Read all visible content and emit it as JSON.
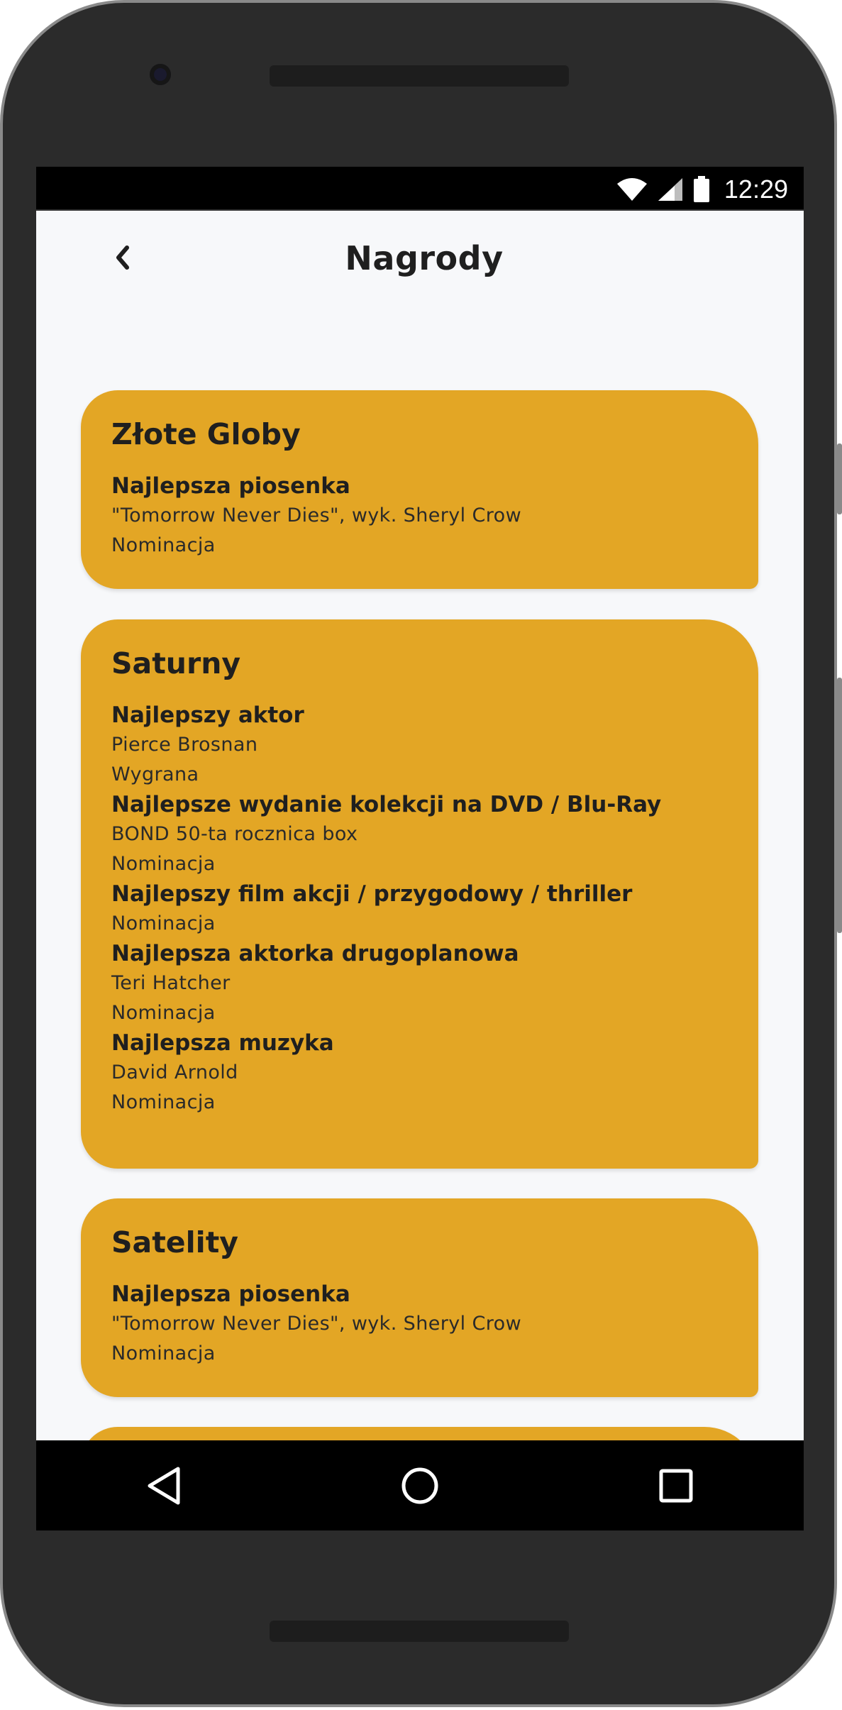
{
  "status_bar": {
    "time": "12:29",
    "icons": [
      "wifi-icon",
      "cellular-signal-icon",
      "battery-icon"
    ]
  },
  "app_bar": {
    "back_icon": "chevron-left-icon",
    "title": "Nagrody"
  },
  "colors": {
    "card_background": "#e3a625",
    "screen_background": "#f7f8fa",
    "text": "#1f1f1f"
  },
  "cards": [
    {
      "title": "Złote Globy",
      "awards": [
        {
          "category": "Najlepsza piosenka",
          "details": [
            "\"Tomorrow Never Dies\", wyk. Sheryl Crow",
            "Nominacja"
          ]
        }
      ]
    },
    {
      "title": "Saturny",
      "awards": [
        {
          "category": "Najlepszy aktor",
          "details": [
            "Pierce Brosnan",
            "Wygrana"
          ]
        },
        {
          "category": "Najlepsze wydanie kolekcji na DVD / Blu-Ray",
          "details": [
            "BOND 50-ta rocznica box",
            "Nominacja"
          ]
        },
        {
          "category": "Najlepszy film akcji / przygodowy / thriller",
          "details": [
            "Nominacja"
          ]
        },
        {
          "category": "Najlepsza aktorka drugoplanowa",
          "details": [
            "Teri Hatcher",
            "Nominacja"
          ]
        },
        {
          "category": "Najlepsza muzyka",
          "details": [
            "David Arnold",
            "Nominacja"
          ]
        }
      ]
    },
    {
      "title": "Satelity",
      "awards": [
        {
          "category": "Najlepsza piosenka",
          "details": [
            "\"Tomorrow Never Dies\", wyk. Sheryl Crow",
            "Nominacja"
          ]
        }
      ]
    }
  ],
  "nav_bar": {
    "buttons": [
      "back-triangle-icon",
      "home-circle-icon",
      "recents-square-icon"
    ]
  }
}
